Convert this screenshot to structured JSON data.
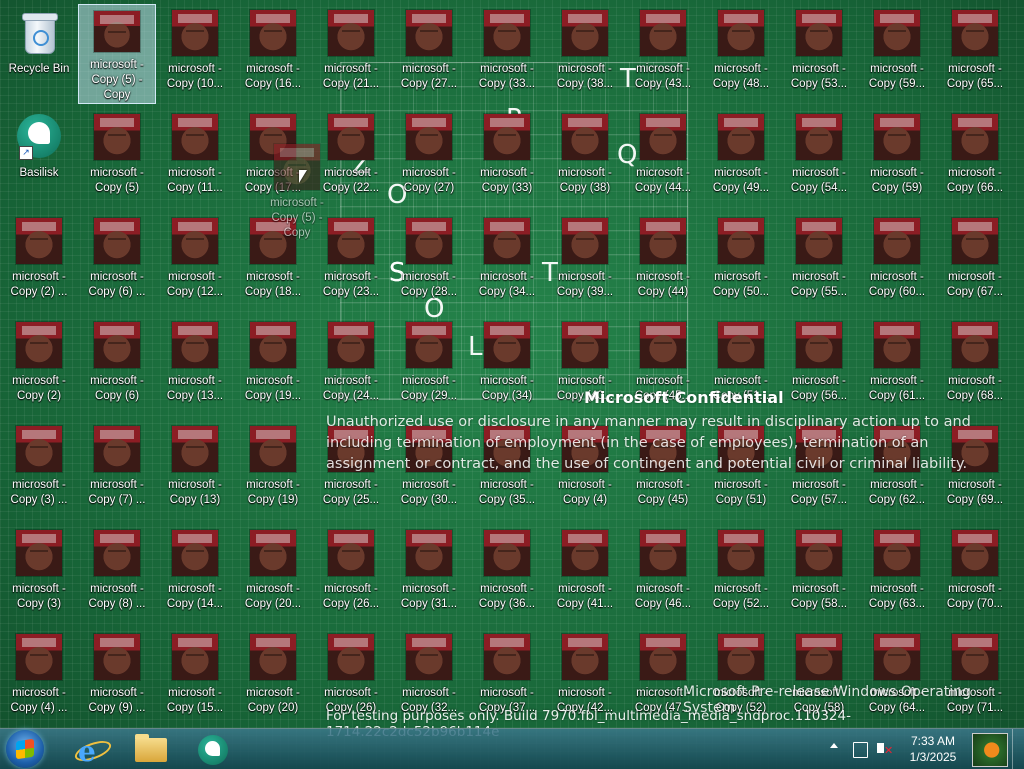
{
  "desktop": {
    "icons": [
      {
        "lines": [
          "Recycle Bin"
        ],
        "kind": "recycle-bin"
      },
      {
        "lines": [
          "microsoft -",
          "Copy (5) -",
          "Copy"
        ],
        "selected": true
      },
      {
        "lines": [
          "microsoft -",
          "Copy (10..."
        ]
      },
      {
        "lines": [
          "microsoft -",
          "Copy (16..."
        ]
      },
      {
        "lines": [
          "microsoft -",
          "Copy (21..."
        ]
      },
      {
        "lines": [
          "microsoft -",
          "Copy (27..."
        ]
      },
      {
        "lines": [
          "microsoft -",
          "Copy (33..."
        ]
      },
      {
        "lines": [
          "microsoft -",
          "Copy (38..."
        ]
      },
      {
        "lines": [
          "microsoft -",
          "Copy (43..."
        ]
      },
      {
        "lines": [
          "microsoft -",
          "Copy (48..."
        ]
      },
      {
        "lines": [
          "microsoft -",
          "Copy (53..."
        ]
      },
      {
        "lines": [
          "microsoft -",
          "Copy (59..."
        ]
      },
      {
        "lines": [
          "microsoft -",
          "Copy (65..."
        ]
      },
      {
        "lines": [
          "Basilisk"
        ],
        "kind": "basilisk"
      },
      {
        "lines": [
          "microsoft -",
          "Copy (5)"
        ]
      },
      {
        "lines": [
          "microsoft -",
          "Copy (11..."
        ]
      },
      {
        "lines": [
          "microsoft -",
          "Copy (17..."
        ]
      },
      {
        "lines": [
          "microsoft -",
          "Copy (22..."
        ]
      },
      {
        "lines": [
          "microsoft -",
          "Copy (27)"
        ]
      },
      {
        "lines": [
          "microsoft -",
          "Copy (33)"
        ]
      },
      {
        "lines": [
          "microsoft -",
          "Copy (38)"
        ]
      },
      {
        "lines": [
          "microsoft -",
          "Copy (44..."
        ]
      },
      {
        "lines": [
          "microsoft -",
          "Copy (49..."
        ]
      },
      {
        "lines": [
          "microsoft -",
          "Copy (54..."
        ]
      },
      {
        "lines": [
          "microsoft -",
          "Copy (59)"
        ]
      },
      {
        "lines": [
          "microsoft -",
          "Copy (66..."
        ]
      },
      {
        "lines": [
          "microsoft -",
          "Copy (2) ..."
        ]
      },
      {
        "lines": [
          "microsoft -",
          "Copy (6) ..."
        ]
      },
      {
        "lines": [
          "microsoft -",
          "Copy (12..."
        ]
      },
      {
        "lines": [
          "microsoft -",
          "Copy (18..."
        ]
      },
      {
        "lines": [
          "microsoft -",
          "Copy (23..."
        ]
      },
      {
        "lines": [
          "microsoft -",
          "Copy (28..."
        ]
      },
      {
        "lines": [
          "microsoft -",
          "Copy (34..."
        ]
      },
      {
        "lines": [
          "microsoft -",
          "Copy (39..."
        ]
      },
      {
        "lines": [
          "microsoft -",
          "Copy (44)"
        ]
      },
      {
        "lines": [
          "microsoft -",
          "Copy (50..."
        ]
      },
      {
        "lines": [
          "microsoft -",
          "Copy (55..."
        ]
      },
      {
        "lines": [
          "microsoft -",
          "Copy (60..."
        ]
      },
      {
        "lines": [
          "microsoft -",
          "Copy (67..."
        ]
      },
      {
        "lines": [
          "microsoft -",
          "Copy (2)"
        ]
      },
      {
        "lines": [
          "microsoft -",
          "Copy (6)"
        ]
      },
      {
        "lines": [
          "microsoft -",
          "Copy (13..."
        ]
      },
      {
        "lines": [
          "microsoft -",
          "Copy (19..."
        ]
      },
      {
        "lines": [
          "microsoft -",
          "Copy (24..."
        ]
      },
      {
        "lines": [
          "microsoft -",
          "Copy (29..."
        ]
      },
      {
        "lines": [
          "microsoft -",
          "Copy (34)"
        ]
      },
      {
        "lines": [
          "microsoft -",
          "Copy (40..."
        ]
      },
      {
        "lines": [
          "microsoft -",
          "Copy (45..."
        ]
      },
      {
        "lines": [
          "microsoft -",
          "Copy (51..."
        ]
      },
      {
        "lines": [
          "microsoft -",
          "Copy (56..."
        ]
      },
      {
        "lines": [
          "microsoft -",
          "Copy (61..."
        ]
      },
      {
        "lines": [
          "microsoft -",
          "Copy (68..."
        ]
      },
      {
        "lines": [
          "microsoft -",
          "Copy (3) ..."
        ]
      },
      {
        "lines": [
          "microsoft -",
          "Copy (7) ..."
        ]
      },
      {
        "lines": [
          "microsoft -",
          "Copy (13)"
        ]
      },
      {
        "lines": [
          "microsoft -",
          "Copy (19)"
        ]
      },
      {
        "lines": [
          "microsoft -",
          "Copy (25..."
        ]
      },
      {
        "lines": [
          "microsoft -",
          "Copy (30..."
        ]
      },
      {
        "lines": [
          "microsoft -",
          "Copy (35..."
        ]
      },
      {
        "lines": [
          "microsoft -",
          "Copy (4)"
        ]
      },
      {
        "lines": [
          "microsoft -",
          "Copy (45)"
        ]
      },
      {
        "lines": [
          "microsoft -",
          "Copy (51)"
        ]
      },
      {
        "lines": [
          "microsoft -",
          "Copy (57..."
        ]
      },
      {
        "lines": [
          "microsoft -",
          "Copy (62..."
        ]
      },
      {
        "lines": [
          "microsoft -",
          "Copy (69..."
        ]
      },
      {
        "lines": [
          "microsoft -",
          "Copy (3)"
        ]
      },
      {
        "lines": [
          "microsoft -",
          "Copy (8) ..."
        ]
      },
      {
        "lines": [
          "microsoft -",
          "Copy (14..."
        ]
      },
      {
        "lines": [
          "microsoft -",
          "Copy (20..."
        ]
      },
      {
        "lines": [
          "microsoft -",
          "Copy (26..."
        ]
      },
      {
        "lines": [
          "microsoft -",
          "Copy (31..."
        ]
      },
      {
        "lines": [
          "microsoft -",
          "Copy (36..."
        ]
      },
      {
        "lines": [
          "microsoft -",
          "Copy (41..."
        ]
      },
      {
        "lines": [
          "microsoft -",
          "Copy (46..."
        ]
      },
      {
        "lines": [
          "microsoft -",
          "Copy (52..."
        ]
      },
      {
        "lines": [
          "microsoft -",
          "Copy (58..."
        ]
      },
      {
        "lines": [
          "microsoft -",
          "Copy (63..."
        ]
      },
      {
        "lines": [
          "microsoft -",
          "Copy (70..."
        ]
      },
      {
        "lines": [
          "microsoft -",
          "Copy (4) ..."
        ]
      },
      {
        "lines": [
          "microsoft -",
          "Copy (9) ..."
        ]
      },
      {
        "lines": [
          "microsoft -",
          "Copy (15..."
        ]
      },
      {
        "lines": [
          "microsoft -",
          "Copy (20)"
        ]
      },
      {
        "lines": [
          "microsoft -",
          "Copy (26)"
        ]
      },
      {
        "lines": [
          "microsoft -",
          "Copy (32..."
        ]
      },
      {
        "lines": [
          "microsoft -",
          "Copy (37..."
        ]
      },
      {
        "lines": [
          "microsoft -",
          "Copy (42..."
        ]
      },
      {
        "lines": [
          "microsoft -",
          "Copy (47..."
        ]
      },
      {
        "lines": [
          "microsoft -",
          "Copy (52)"
        ]
      },
      {
        "lines": [
          "microsoft -",
          "Copy (58)"
        ]
      },
      {
        "lines": [
          "microsoft -",
          "Copy (64..."
        ]
      },
      {
        "lines": [
          "microsoft -",
          "Copy (71..."
        ]
      }
    ],
    "drag_ghost": {
      "lines": [
        "microsoft -",
        "Copy (5) -",
        "Copy"
      ]
    }
  },
  "wallpaper": {
    "letters": [
      "T",
      "Q",
      "S",
      "O",
      "S",
      "T",
      "O",
      "L",
      "P",
      "Z"
    ]
  },
  "watermark": {
    "title": "Microsoft Confidential",
    "body": "Unauthorized use or disclosure in any manner may result in disciplinary action up to and including termination of employment (in the case of employees), termination of an assignment or contract, and the use of contingent and potential civil or criminal liability.",
    "line1": "Microsoft Pre-release Windows Operating System",
    "line2": "For testing purposes only. Build 7970.fbl_multimedia_media_sndproc.110324-1714.22c2dc52b96b114e"
  },
  "taskbar": {
    "clock_time": "7:33 AM",
    "clock_date": "1/3/2025",
    "pinned": [
      "internet-explorer",
      "windows-explorer",
      "basilisk"
    ]
  }
}
